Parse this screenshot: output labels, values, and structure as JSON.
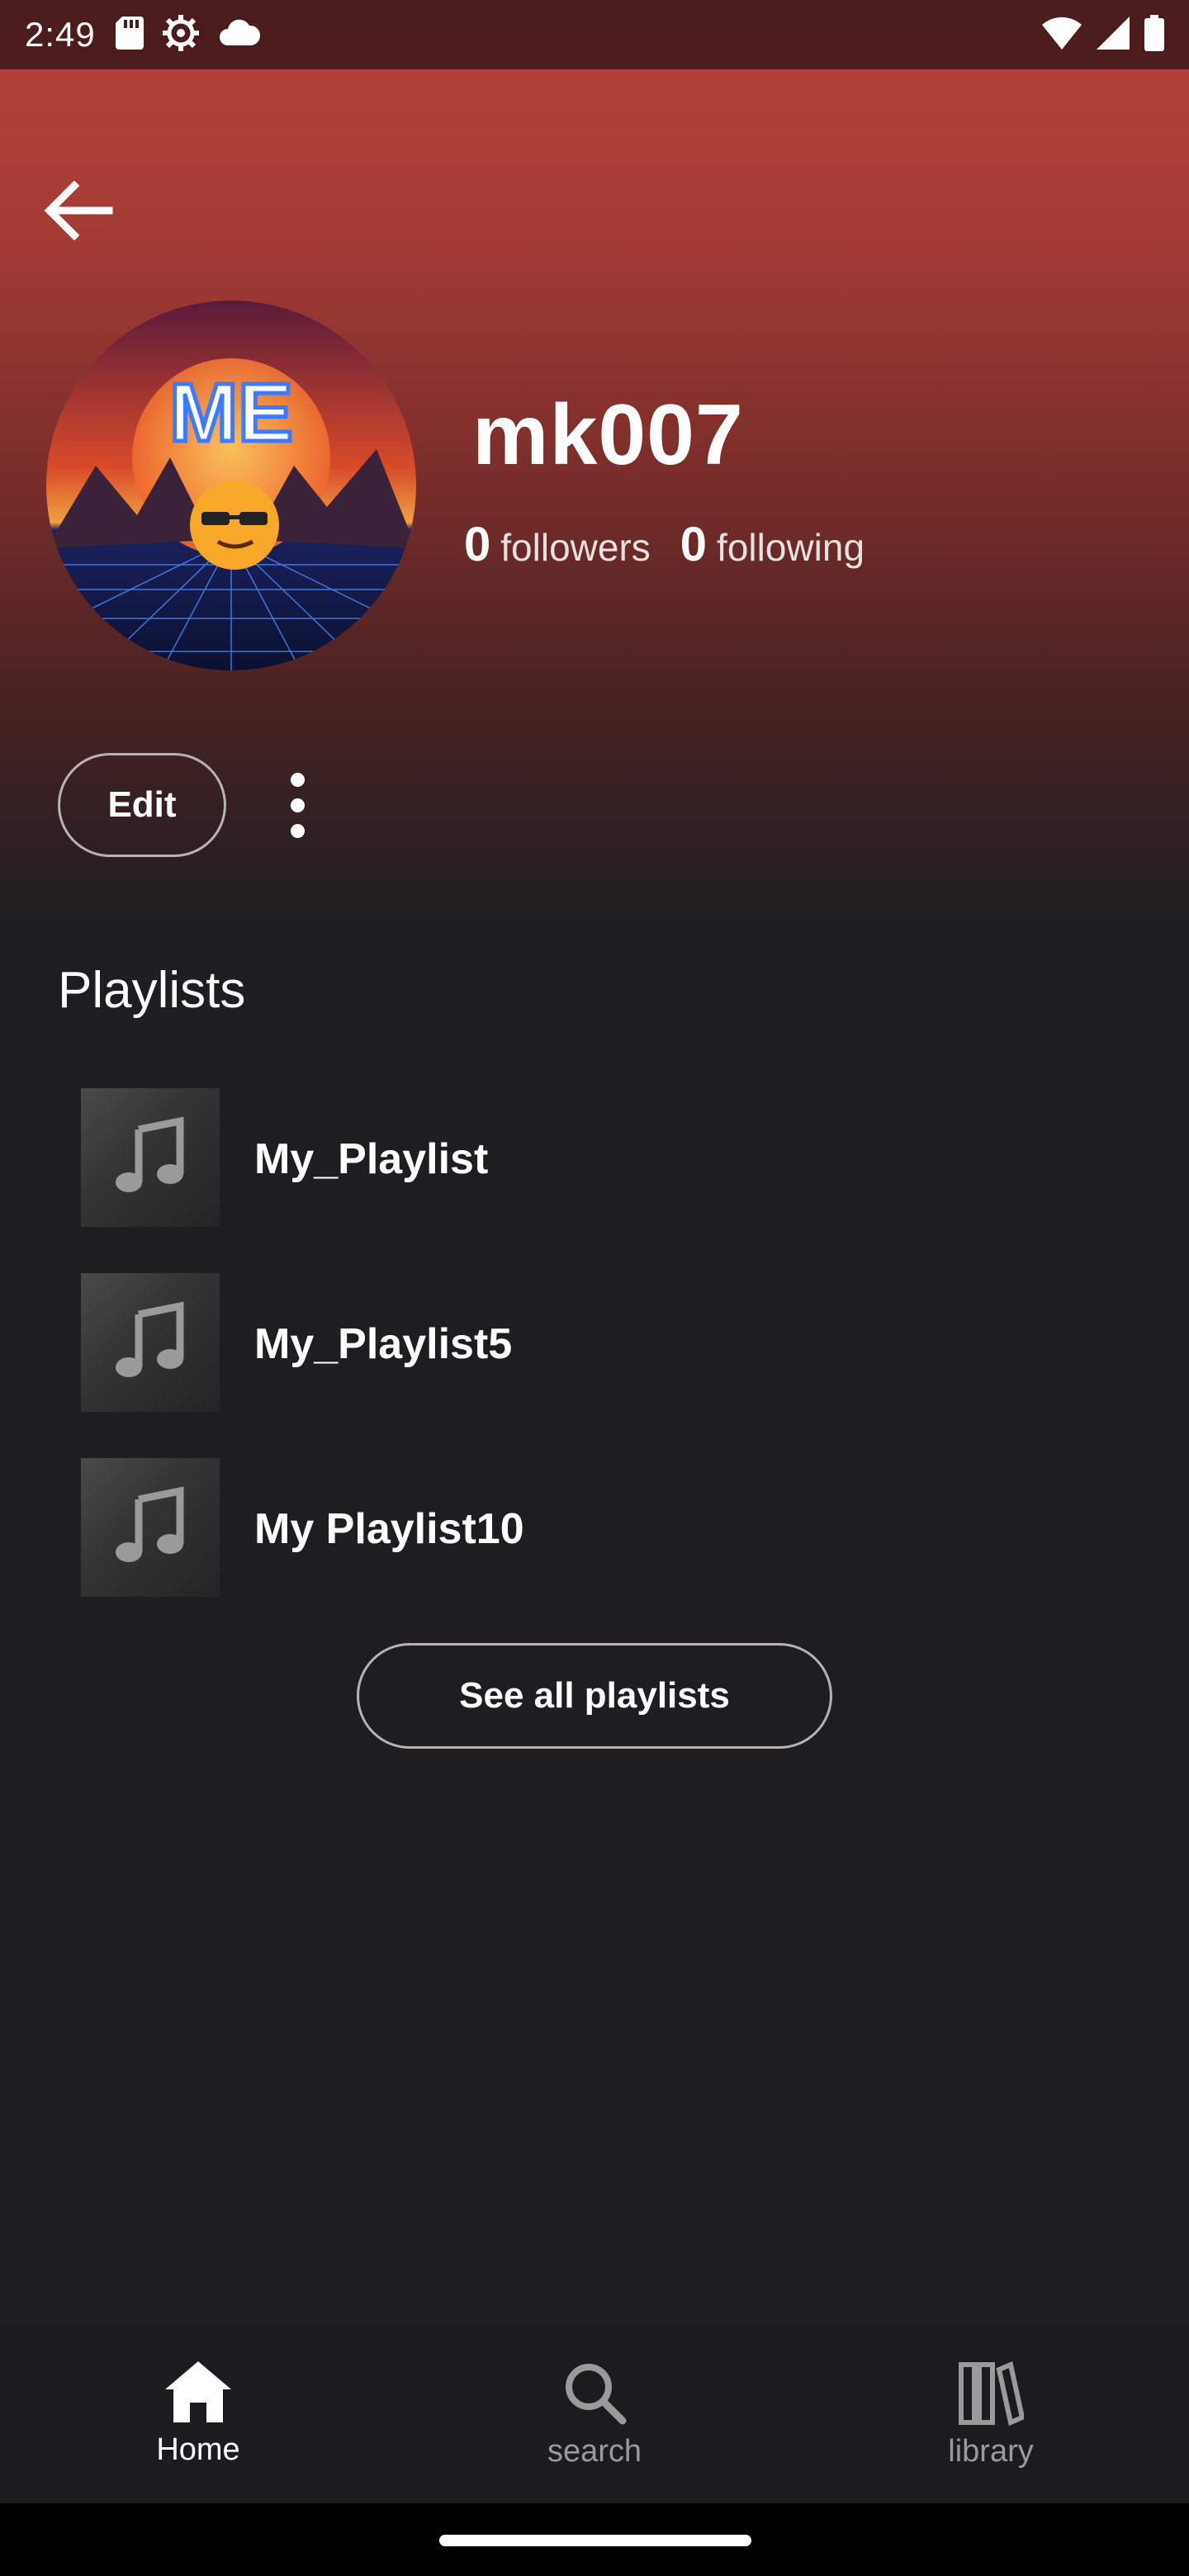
{
  "status_bar": {
    "time": "2:49",
    "left_icons": [
      "sd-card-icon",
      "settings-icon",
      "cloud-icon"
    ],
    "right_icons": [
      "wifi-icon",
      "signal-icon",
      "battery-icon"
    ]
  },
  "profile": {
    "username": "mk007",
    "avatar_text": "ME",
    "followers_count": "0",
    "followers_label": "followers",
    "following_count": "0",
    "following_label": "following",
    "edit_label": "Edit"
  },
  "playlists": {
    "title": "Playlists",
    "items": [
      {
        "name": "My_Playlist"
      },
      {
        "name": "My_Playlist5"
      },
      {
        "name": "My Playlist10"
      }
    ],
    "see_all_label": "See all playlists"
  },
  "bottom_nav": {
    "items": [
      {
        "label": "Home",
        "icon": "home-icon",
        "active": true
      },
      {
        "label": "search",
        "icon": "search-icon",
        "active": false
      },
      {
        "label": "library",
        "icon": "library-icon",
        "active": false
      }
    ]
  },
  "colors": {
    "background": "#1e1e20",
    "header_top": "#b3403a",
    "status_bar": "#4a1c1c",
    "text": "#ffffff",
    "inactive_nav": "#9a9a9a"
  }
}
